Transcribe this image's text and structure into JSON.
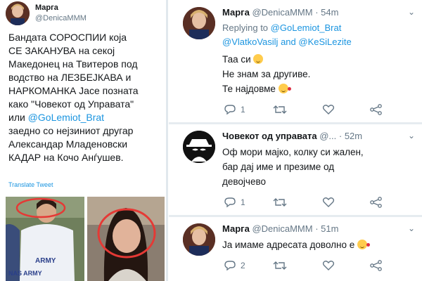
{
  "left_tweet": {
    "author_name": "Марга",
    "author_handle": "@DenicaMMM",
    "body_lines": [
      "Бандата СОРОСПИИ која",
      "СЕ ЗАКАНУВА на секој",
      "Македонец на Твитеров под",
      "водство на ЛЕЗБЕЈКАВА и",
      "НАРКОМАНКА Јасе позната",
      "како \"Човекот од Управата\""
    ],
    "body_or": "или",
    "body_mention": "@GoLemiot_Brat",
    "body_lines_after": [
      "заедно со нејзиниот другар",
      "Александар Младеновски",
      "КАДАР на Кочо Анѓушев."
    ],
    "translate_label": "Translate Tweet",
    "photo_shirt_text_1": "ARMY",
    "photo_shirt_text_2": "NAS ARMY"
  },
  "tweets": [
    {
      "author_name": "Марга",
      "author_handle": "@DenicaMMM",
      "time": "· 54m",
      "replying_to_label": "Replying to",
      "replying_mention_1": "@GoLemiot_Brat",
      "replying_mention_2": "@VlatkoVasilj",
      "replying_and": "and",
      "replying_mention_3": "@KeSiLezite",
      "lines": [
        "Таа си",
        "Не знам за другиве.",
        "Те најдовме"
      ],
      "reply_count": "1",
      "retweet_count": "",
      "like_count": ""
    },
    {
      "author_name": "Човекот од управата",
      "author_handle": "@...",
      "time": "· 52m",
      "lines": [
        "Оф мори мајко, колку си жален,",
        "бар дај име и презиме од",
        "девојчево"
      ],
      "reply_count": "1",
      "retweet_count": "",
      "like_count": ""
    },
    {
      "author_name": "Марга",
      "author_handle": "@DenicaMMM",
      "time": "· 51m",
      "lines": [
        "Ја имаме адресата доволно е"
      ],
      "reply_count": "2",
      "retweet_count": "",
      "like_count": ""
    }
  ],
  "icons": {
    "reply": "reply-icon",
    "retweet": "retweet-icon",
    "like": "heart-icon",
    "share": "share-icon",
    "chevron": "chevron-down-icon"
  },
  "colors": {
    "link": "#1b95e0",
    "secondary_text": "#657786",
    "divider": "#e6ecf0"
  }
}
